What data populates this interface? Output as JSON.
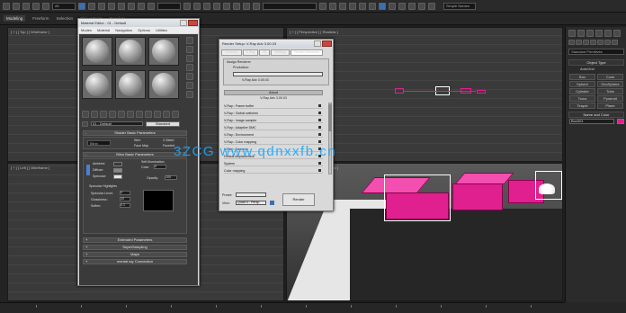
{
  "toolbar": {
    "view_dropdown": "All",
    "layer_dropdown": "",
    "workspace_label": "Simple Names"
  },
  "ribbon": {
    "tabs": [
      "Modeling",
      "Freeform",
      "Selection",
      "Object Paint",
      "Populate"
    ],
    "sublabel": "Polygon Modeling"
  },
  "viewports": {
    "top_left_label": "[ + ] [ Top ] [ Wireframe ]",
    "top_right_label": "[ + ] [ Perspective ] [ Realistic ]",
    "left_label": "[ + ] [ Left ] [ Wireframe ]",
    "persp_label": "[ + ] [ Perspective ] [ Realistic ]"
  },
  "material_editor": {
    "title": "Material Editor - 01 - Default",
    "menu": [
      "Modes",
      "Material",
      "Navigation",
      "Options",
      "Utilities"
    ],
    "material_name": "01 - Default",
    "material_type": "Standard",
    "rollouts": {
      "shader_basic": "Shader Basic Parameters",
      "blinn_basic": "Blinn Basic Parameters",
      "extended": "Extended Parameters",
      "supersampling": "SuperSampling",
      "maps": "Maps",
      "mental_ray": "mental ray Connection"
    },
    "shader": "Blinn",
    "checks": [
      "Wire",
      "2-Sided",
      "Face Map",
      "Faceted"
    ],
    "color_labels": [
      "Ambient:",
      "Diffuse:",
      "Specular:"
    ],
    "self_illum": "Self-Illumination",
    "color_label": "Color",
    "color_value": "0",
    "opacity_label": "Opacity:",
    "opacity_value": "100",
    "spec_highlights": "Specular Highlights",
    "spec_level_label": "Specular Level:",
    "spec_level_value": "0",
    "gloss_label": "Glossiness:",
    "gloss_value": "10",
    "soften_label": "Soften:",
    "soften_value": "0.1"
  },
  "render_setup": {
    "title": "Render Setup: V-Ray Adv 3.00.03",
    "tabs": [
      "Common",
      "V-Ray",
      "GI",
      "Settings",
      "Render Elements"
    ],
    "assign_label": "Assign Renderer",
    "production_label": "Production:",
    "production_value": "V-Ray Adv 3.00.03",
    "about_label": "About",
    "about_value": "V-Ray Adv 3.00.03",
    "rows": [
      "V-Ray:: Frame buffer",
      "V-Ray:: Global switches",
      "V-Ray:: Image sampler",
      "V-Ray:: Adaptive DMC",
      "V-Ray:: Environment",
      "V-Ray:: Color mapping",
      "V-Ray:: Camera"
    ],
    "extra_rows": [
      "Default displacement",
      "System",
      "Color mapping"
    ],
    "preset_label": "Preset:",
    "view_label": "View:",
    "view_value": "Quad 4 - Persp",
    "render_button": "Render"
  },
  "command_panel": {
    "dropdown": "Standard Primitives",
    "object_type": "Object Type",
    "autogrid": "AutoGrid",
    "buttons": [
      "Box",
      "Cone",
      "Sphere",
      "GeoSphere",
      "Cylinder",
      "Tube",
      "Torus",
      "Pyramid",
      "Teapot",
      "Plane"
    ],
    "name_color": "Name and Color",
    "name_value": "Box001",
    "swatch_color": "#e0208f"
  },
  "watermark": "3ZCG www.qdnxxfb.cn"
}
